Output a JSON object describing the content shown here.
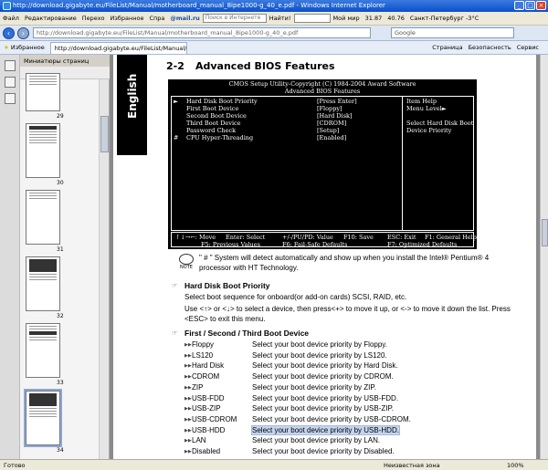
{
  "window": {
    "title": "http://download.gigabyte.eu/FileList/Manual/motherboard_manual_8ipe1000-g_40_e.pdf - Windows Internet Explorer"
  },
  "menubar": {
    "items": [
      "Файл",
      "Редактирование",
      "Перехо",
      "Избранное",
      "Спра"
    ],
    "mail_brand": "@mail.ru",
    "search_placeholder": "Поиск в Интернете",
    "find_label": "Найти!",
    "my_world": "Мой мир",
    "stat1": "31.87",
    "stat2": "40.76",
    "weather": "Санкт-Петербург -3°C"
  },
  "addressbar": {
    "url": "http://download.gigabyte.eu/FileList/Manual/motherboard_manual_8ipe1000-g_40_e.pdf",
    "search_engine": "Google"
  },
  "tabs": {
    "favorites_label": "Избранное",
    "active_tab": "http://download.gigabyte.eu/FileList/Manual/motherboard...",
    "page_menu": "Страница",
    "safety_menu": "Безопасность",
    "service_menu": "Сервис"
  },
  "sidebar": {
    "title": "Миниатюры страниц",
    "thumbnails": [
      {
        "num": "29"
      },
      {
        "num": "30"
      },
      {
        "num": "31"
      },
      {
        "num": "32"
      },
      {
        "num": "33"
      },
      {
        "num": "34"
      }
    ]
  },
  "document": {
    "side_tab": "English",
    "section_number": "2-2",
    "section_title": "Advanced BIOS Features",
    "bios": {
      "header1": "CMOS Setup Utility-Copyright (C) 1984-2004 Award Software",
      "header2": "Advanced BIOS Features",
      "rows": [
        {
          "prefix": "►",
          "label": "Hard Disk Boot Priority",
          "value": "[Press Enter]"
        },
        {
          "prefix": "",
          "label": "First Boot Device",
          "value": "[Floppy]"
        },
        {
          "prefix": "",
          "label": "Second Boot Device",
          "value": "[Hard Disk]"
        },
        {
          "prefix": "",
          "label": "Third Boot Device",
          "value": "[CDROM]"
        },
        {
          "prefix": "",
          "label": "Password Check",
          "value": "[Setup]"
        },
        {
          "prefix": "#",
          "label": "CPU Hyper-Threading",
          "value": "[Enabled]"
        }
      ],
      "help_title": "Item Help",
      "help_menu": "Menu Level►",
      "help_text1": "Select Hard Disk Boot",
      "help_text2": "Device Priority",
      "footer": {
        "move": "↑↓→←: Move",
        "enter": "Enter: Select",
        "value": "+/-/PU/PD: Value",
        "save": "F10: Save",
        "exit": "ESC: Exit",
        "help": "F1: General Help",
        "prev": "F5: Previous Values",
        "failsafe": "F6: Fail-Safe Defaults",
        "optimized": "F7: Optimized Defaults"
      }
    },
    "note_label": "NOTE",
    "note_text1": "\" # \" System will detect automatically and show up when you install the Intel® Pentium® 4",
    "note_text2": "processor with HT Technology.",
    "hdd_heading": "Hard Disk Boot Priority",
    "hdd_text1": "Select boot sequence for onboard(or add-on cards) SCSI, RAID, etc.",
    "hdd_text2": "Use <↑> or <↓> to select a device, then press<+> to move it up, or <-> to move it down the list. Press",
    "hdd_text3": "<ESC> to exit this menu.",
    "boot_heading": "First / Second / Third Boot Device",
    "boot_items": [
      {
        "name": "Floppy",
        "desc": "Select your boot device priority by Floppy."
      },
      {
        "name": "LS120",
        "desc": "Select your boot device priority by LS120."
      },
      {
        "name": "Hard Disk",
        "desc": "Select your boot device priority by Hard Disk."
      },
      {
        "name": "CDROM",
        "desc": "Select your boot device priority by CDROM."
      },
      {
        "name": "ZIP",
        "desc": "Select your boot device priority by ZIP."
      },
      {
        "name": "USB-FDD",
        "desc": "Select your boot device priority by USB-FDD."
      },
      {
        "name": "USB-ZIP",
        "desc": "Select your boot device priority by USB-ZIP."
      },
      {
        "name": "USB-CDROM",
        "desc": "Select your boot device priority by USB-CDROM."
      },
      {
        "name": "USB-HDD",
        "desc": "Select your boot device priority by USB-HDD."
      },
      {
        "name": "LAN",
        "desc": "Select your boot device priority by LAN."
      },
      {
        "name": "Disabled",
        "desc": "Select your boot device priority by Disabled."
      }
    ]
  },
  "status": {
    "left": "Готово",
    "zone": "Неизвестная зона",
    "zoom": "100%"
  }
}
